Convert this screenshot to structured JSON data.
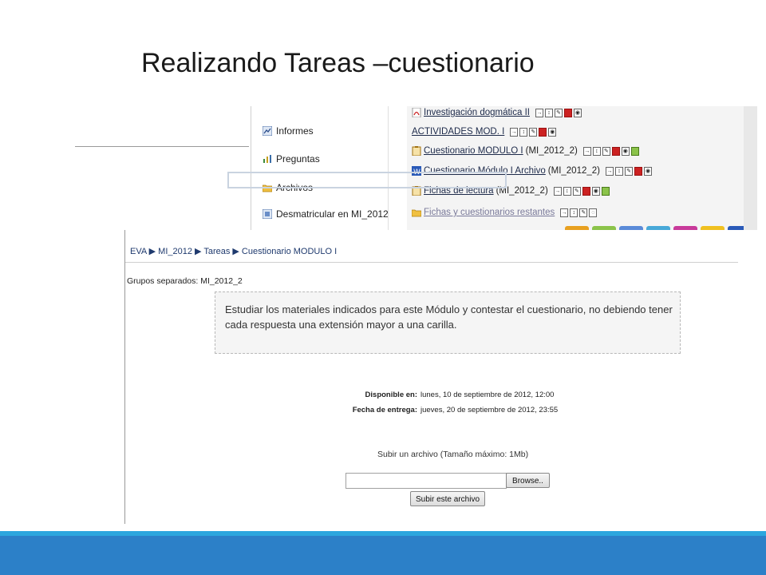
{
  "slide": {
    "title": "Realizando Tareas –cuestionario"
  },
  "left_menu": {
    "items": [
      {
        "label": "Informes",
        "icon": "chart-icon"
      },
      {
        "label": "Preguntas",
        "icon": "questions-icon"
      },
      {
        "label": "Archivos",
        "icon": "folder-icon"
      },
      {
        "label": "Desmatricular en MI_2012",
        "icon": "unenrol-icon"
      }
    ]
  },
  "activities": {
    "rows": [
      {
        "name": "Investigación dogmática II",
        "suffix": ""
      },
      {
        "name": "ACTIVIDADES MOD. I",
        "suffix": ""
      },
      {
        "name": "Cuestionario MODULO I",
        "suffix": " (MI_2012_2)"
      },
      {
        "name": "Cuestionario Módulo I   Archivo",
        "suffix": " (MI_2012_2)"
      },
      {
        "name": "Fichas de lectura",
        "suffix": " (MI_2012_2)"
      },
      {
        "name": "Fichas y cuestionarios restantes",
        "suffix": ""
      }
    ]
  },
  "assignment": {
    "breadcrumb": "EVA ▶ MI_2012 ▶ Tareas ▶ Cuestionario MODULO I",
    "groups": "Grupos separados: MI_2012_2",
    "description": "Estudiar los materiales indicados para este Módulo y contestar el cuestionario, no debiendo tener cada respuesta una extensión mayor a una carilla.",
    "available_label": "Disponible en:",
    "available_value": "lunes, 10 de septiembre de 2012, 12:00",
    "due_label": "Fecha de entrega:",
    "due_value": "jueves, 20 de septiembre de 2012, 23:55",
    "upload_label": "Subir un archivo (Tamaño máximo: 1Mb)",
    "file_value": "",
    "browse_label": "Browse..",
    "submit_label": "Subir este archivo"
  },
  "colors": {
    "footer_main": "#2c80c8",
    "footer_accent": "#2ca6de",
    "link": "#1f3a6e",
    "delete_icon": "#cc2222"
  }
}
